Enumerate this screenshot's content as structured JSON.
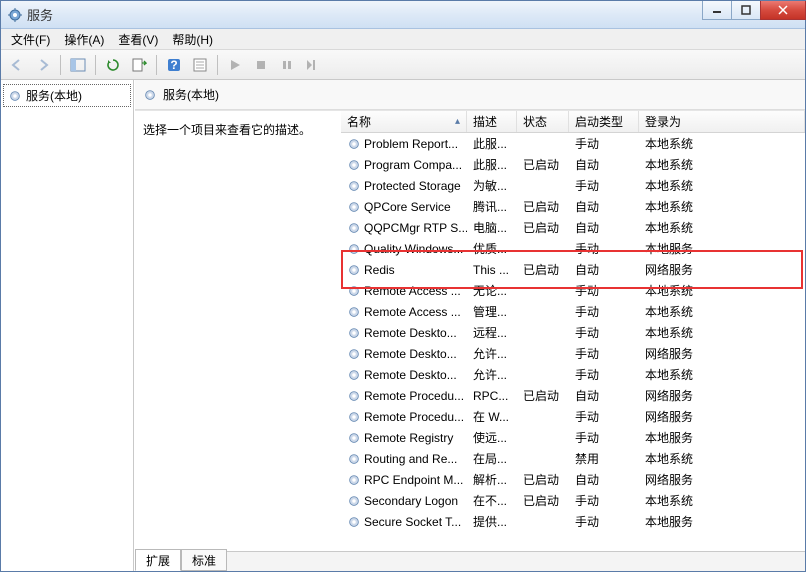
{
  "window": {
    "title": "服务"
  },
  "menu": {
    "file": "文件(F)",
    "action": "操作(A)",
    "view": "查看(V)",
    "help": "帮助(H)"
  },
  "tree": {
    "root": "服务(本地)"
  },
  "right": {
    "header": "服务(本地)",
    "prompt": "选择一个项目来查看它的描述。"
  },
  "columns": {
    "name": "名称",
    "desc": "描述",
    "status": "状态",
    "startup": "启动类型",
    "logon": "登录为"
  },
  "tabs": {
    "extended": "扩展",
    "standard": "标准"
  },
  "services": [
    {
      "name": "Problem Report...",
      "desc": "此服...",
      "status": "",
      "startup": "手动",
      "logon": "本地系统"
    },
    {
      "name": "Program Compa...",
      "desc": "此服...",
      "status": "已启动",
      "startup": "自动",
      "logon": "本地系统"
    },
    {
      "name": "Protected Storage",
      "desc": "为敏...",
      "status": "",
      "startup": "手动",
      "logon": "本地系统"
    },
    {
      "name": "QPCore Service",
      "desc": "腾讯...",
      "status": "已启动",
      "startup": "自动",
      "logon": "本地系统"
    },
    {
      "name": "QQPCMgr RTP S...",
      "desc": "电脑...",
      "status": "已启动",
      "startup": "自动",
      "logon": "本地系统"
    },
    {
      "name": "Quality Windows...",
      "desc": "优质...",
      "status": "",
      "startup": "手动",
      "logon": "本地服务"
    },
    {
      "name": "Redis",
      "desc": "This ...",
      "status": "已启动",
      "startup": "自动",
      "logon": "网络服务"
    },
    {
      "name": "Remote Access ...",
      "desc": "无论...",
      "status": "",
      "startup": "手动",
      "logon": "本地系统"
    },
    {
      "name": "Remote Access ...",
      "desc": "管理...",
      "status": "",
      "startup": "手动",
      "logon": "本地系统"
    },
    {
      "name": "Remote Deskto...",
      "desc": "远程...",
      "status": "",
      "startup": "手动",
      "logon": "本地系统"
    },
    {
      "name": "Remote Deskto...",
      "desc": "允许...",
      "status": "",
      "startup": "手动",
      "logon": "网络服务"
    },
    {
      "name": "Remote Deskto...",
      "desc": "允许...",
      "status": "",
      "startup": "手动",
      "logon": "本地系统"
    },
    {
      "name": "Remote Procedu...",
      "desc": "RPC...",
      "status": "已启动",
      "startup": "自动",
      "logon": "网络服务"
    },
    {
      "name": "Remote Procedu...",
      "desc": "在 W...",
      "status": "",
      "startup": "手动",
      "logon": "网络服务"
    },
    {
      "name": "Remote Registry",
      "desc": "使远...",
      "status": "",
      "startup": "手动",
      "logon": "本地服务"
    },
    {
      "name": "Routing and Re...",
      "desc": "在局...",
      "status": "",
      "startup": "禁用",
      "logon": "本地系统"
    },
    {
      "name": "RPC Endpoint M...",
      "desc": "解析...",
      "status": "已启动",
      "startup": "自动",
      "logon": "网络服务"
    },
    {
      "name": "Secondary Logon",
      "desc": "在不...",
      "status": "已启动",
      "startup": "手动",
      "logon": "本地系统"
    },
    {
      "name": "Secure Socket T...",
      "desc": "提供...",
      "status": "",
      "startup": "手动",
      "logon": "本地服务"
    }
  ]
}
